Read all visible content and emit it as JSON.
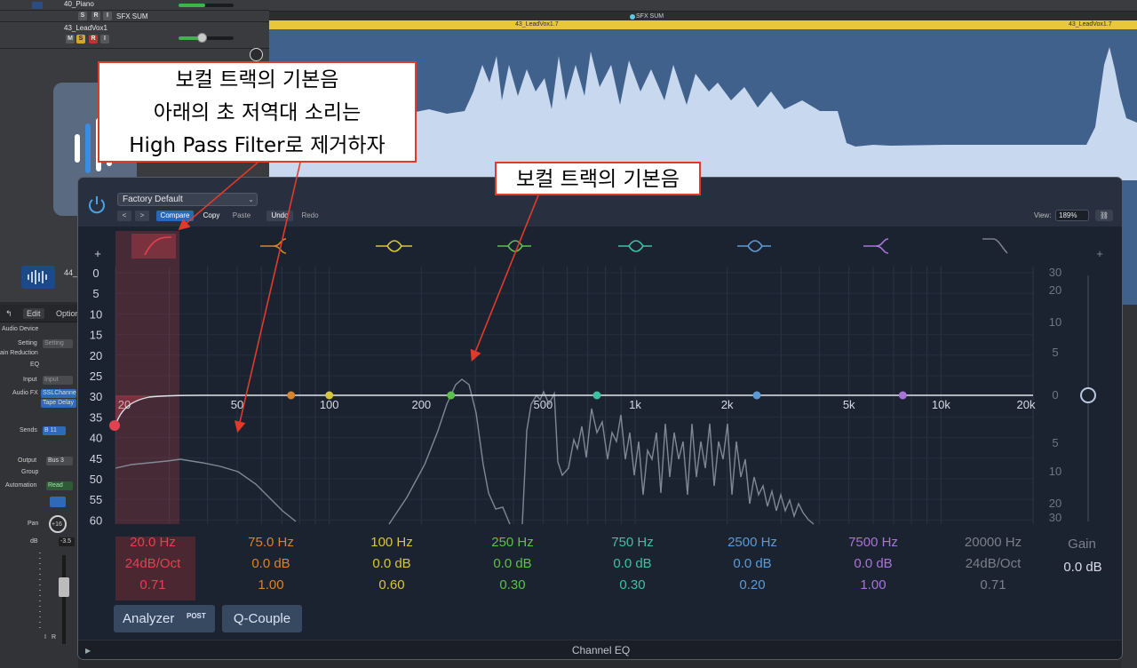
{
  "tracks": {
    "piano_name": "40_Piano",
    "sfx_name": "SFX SUM",
    "leadvox_name": "43_LeadVox1",
    "thumb_name": "44_",
    "btn_m": "M",
    "btn_s": "S",
    "btn_r": "R",
    "btn_i": "I"
  },
  "arrange": {
    "sfx_marker": "SFX SUM",
    "region_left": "43_LeadVox1.7",
    "region_right": "43_LeadVox1.7"
  },
  "mixer": {
    "edit_menu": "Edit",
    "options_menu": "Option",
    "audio_device": "Audio Device",
    "setting_label": "Setting",
    "setting_btn": "Setting",
    "gain_reduction": "ain Reduction",
    "eq": "EQ",
    "input_label": "Input",
    "input_btn": "Input",
    "audio_fx": "Audio FX",
    "fx1": "SSLChannel",
    "fx2": "Tape Delay",
    "sends_label": "Sends",
    "send1": "B 11",
    "output_label": "Output",
    "output_val": "Bus 3",
    "group_label": "Group",
    "automation_label": "Automation",
    "automation_val": "Read",
    "pan_label": "Pan",
    "pan_val": "+16",
    "db_label": "dB",
    "db_val": "-3.5"
  },
  "eq": {
    "preset": "Factory Default",
    "compare": "Compare",
    "copy": "Copy",
    "paste": "Paste",
    "undo": "Undo",
    "redo": "Redo",
    "view_label": "View:",
    "view_zoom": "189%",
    "plus_left": "+",
    "plus_right": "+",
    "freq_ticks": [
      "20",
      "50",
      "100",
      "200",
      "500",
      "1k",
      "2k",
      "5k",
      "10k",
      "20k"
    ],
    "db_left": [
      "0",
      "5",
      "10",
      "15",
      "20",
      "25",
      "30",
      "35",
      "40",
      "45",
      "50",
      "55",
      "60"
    ],
    "db_right_top": [
      "30",
      "20",
      "10",
      "5",
      "0"
    ],
    "db_right_bottom": [
      "5",
      "10",
      "20",
      "30"
    ],
    "bands": [
      {
        "freq": "20.0 Hz",
        "gain": "24dB/Oct",
        "q": "0.71",
        "color": "#e0434f"
      },
      {
        "freq": "75.0 Hz",
        "gain": "0.0 dB",
        "q": "1.00",
        "color": "#d9832b"
      },
      {
        "freq": "100 Hz",
        "gain": "0.0 dB",
        "q": "0.60",
        "color": "#d6c63a"
      },
      {
        "freq": "250 Hz",
        "gain": "0.0 dB",
        "q": "0.30",
        "color": "#5cc04c"
      },
      {
        "freq": "750 Hz",
        "gain": "0.0 dB",
        "q": "0.30",
        "color": "#3cc2a0"
      },
      {
        "freq": "2500 Hz",
        "gain": "0.0 dB",
        "q": "0.20",
        "color": "#5b9ad6"
      },
      {
        "freq": "7500 Hz",
        "gain": "0.0 dB",
        "q": "1.00",
        "color": "#a874d8"
      },
      {
        "freq": "20000 Hz",
        "gain": "24dB/Oct",
        "q": "0.71",
        "color": "#7a7f88"
      }
    ],
    "gain_label": "Gain",
    "gain_value": "0.0 dB",
    "analyzer": "Analyzer",
    "analyzer_post": "POST",
    "qcouple": "Q-Couple",
    "title": "Channel EQ"
  },
  "annotations": {
    "note1_line1": "보컬 트랙의 기본음",
    "note1_line2": "아래의 초 저역대 소리는",
    "note1_line3": "High Pass Filter로 제거하자",
    "note2": "보컬 트랙의 기본음"
  }
}
